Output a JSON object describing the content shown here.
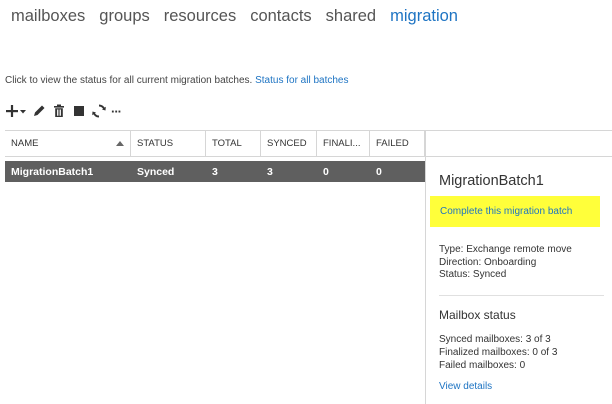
{
  "nav": {
    "items": [
      {
        "label": "mailboxes",
        "active": false
      },
      {
        "label": "groups",
        "active": false
      },
      {
        "label": "resources",
        "active": false
      },
      {
        "label": "contacts",
        "active": false
      },
      {
        "label": "shared",
        "active": false
      },
      {
        "label": "migration",
        "active": true
      }
    ]
  },
  "info": {
    "text": "Click to view the status for all current migration batches.",
    "link": "Status for all batches"
  },
  "toolbar": {
    "icons": [
      "add-icon",
      "edit-icon",
      "delete-icon",
      "stop-icon",
      "refresh-icon",
      "more-icon"
    ],
    "more_label": "···"
  },
  "grid": {
    "headers": [
      "NAME",
      "STATUS",
      "TOTAL",
      "SYNCED",
      "FINALI...",
      "FAILED"
    ],
    "rows": [
      {
        "name": "MigrationBatch1",
        "status": "Synced",
        "total": "3",
        "synced": "3",
        "finalized": "0",
        "failed": "0"
      }
    ]
  },
  "details": {
    "title": "MigrationBatch1",
    "complete_link": "Complete this migration batch",
    "type": "Type: Exchange remote move",
    "direction": "Direction: Onboarding",
    "status": "Status: Synced",
    "mailbox_status_title": "Mailbox status",
    "synced_mailboxes": "Synced mailboxes: 3 of 3",
    "finalized_mailboxes": "Finalized mailboxes: 0 of 3",
    "failed_mailboxes": "Failed mailboxes: 0",
    "view_details": "View details"
  },
  "colors": {
    "accent": "#1e74c3",
    "selected_row": "#5f5f5f",
    "highlight": "#ffff3a"
  }
}
